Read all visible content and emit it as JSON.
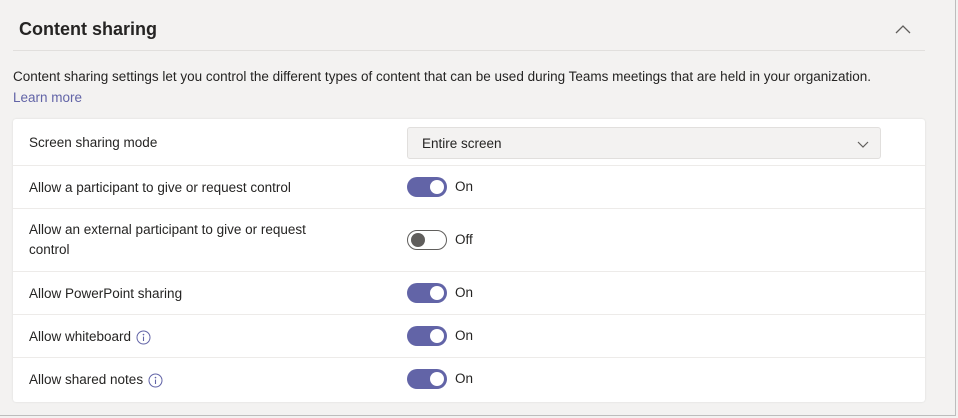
{
  "section": {
    "title": "Content sharing",
    "description": "Content sharing settings let you control the different types of content that can be used during Teams meetings that are held in your organization.",
    "learn_more": "Learn more"
  },
  "settings": {
    "screen_sharing": {
      "label": "Screen sharing mode",
      "value": "Entire screen"
    },
    "give_request_control": {
      "label": "Allow a participant to give or request control",
      "state": "On"
    },
    "external_control": {
      "label_line1": "Allow an external participant to give or request",
      "label_line2": "control",
      "state": "Off"
    },
    "powerpoint_sharing": {
      "label": "Allow PowerPoint sharing",
      "state": "On"
    },
    "whiteboard": {
      "label": "Allow whiteboard",
      "state": "On"
    },
    "shared_notes": {
      "label": "Allow shared notes",
      "state": "On"
    }
  },
  "icons": {
    "collapse": "chevron-up-icon",
    "dropdown": "chevron-down-icon",
    "info": "info-icon"
  },
  "colors": {
    "accent": "#6264a7",
    "toggle_off": "#605e5c"
  }
}
